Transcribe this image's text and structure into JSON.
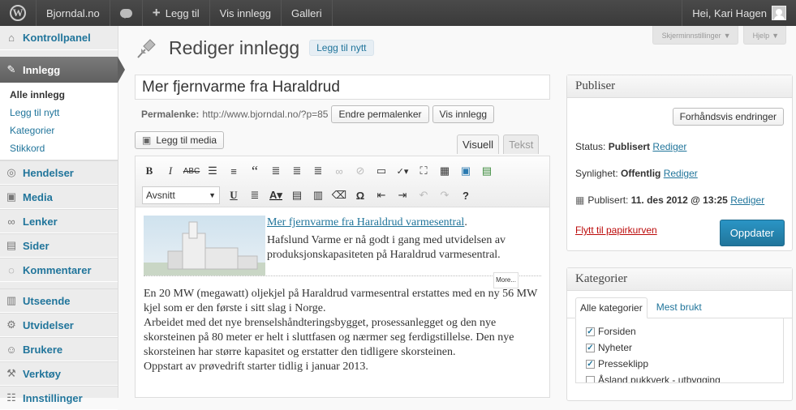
{
  "adminbar": {
    "site_name": "Bjorndal.no",
    "new_label": "Legg til",
    "view_posts": "Vis innlegg",
    "gallery": "Galleri",
    "greeting": "Hei, Kari Hagen"
  },
  "sidebar": {
    "dashboard": "Kontrollpanel",
    "posts": "Innlegg",
    "posts_sub": [
      "Alle innlegg",
      "Legg til nytt",
      "Kategorier",
      "Stikkord"
    ],
    "items_a": [
      "Hendelser",
      "Media",
      "Lenker",
      "Sider",
      "Kommentarer"
    ],
    "items_b": [
      "Utseende",
      "Utvidelser",
      "Brukere",
      "Verktøy",
      "Innstillinger"
    ]
  },
  "screen_options": "Skjerminnstillinger",
  "help": "Hjelp",
  "page": {
    "heading": "Rediger innlegg",
    "add_new": "Legg til nytt",
    "post_title": "Mer fjernvarme fra Haraldrud",
    "permalink_label": "Permalenke:",
    "permalink_url": "http://www.bjorndal.no/?p=85",
    "change_permalinks": "Endre permalenker",
    "view_post": "Vis innlegg",
    "add_media": "Legg til media",
    "tab_visual": "Visuell",
    "tab_text": "Tekst",
    "format_select": "Avsnitt"
  },
  "content": {
    "link_text": "Mer fjernvarme fra Haraldrud varmesentral",
    "link_suffix": ".",
    "intro": "Hafslund Varme er nå godt i gang med utvidelsen av produksjonskapasiteten på Haraldrud varmesentral.",
    "more_tag": "More...",
    "p1": "En 20 MW (megawatt) oljekjel på Haraldrud varmesentral erstattes med en ny 56 MW kjel som er den første i sitt slag i Norge.",
    "p2": "Arbeidet med det nye brenselshåndteringsbygget, prosessanlegget og den nye skorsteinen på 80 meter er helt i sluttfasen og nærmer seg ferdigstillelse. Den nye skorsteinen har større kapasitet og erstatter den tidligere skorsteinen.",
    "p3": "Oppstart av prøvedrift starter tidlig i januar 2013."
  },
  "publish": {
    "title": "Publiser",
    "preview": "Forhåndsvis endringer",
    "status_label": "Status:",
    "status_value": "Publisert",
    "visibility_label": "Synlighet:",
    "visibility_value": "Offentlig",
    "published_label": "Publisert:",
    "published_value": "11. des 2012 @ 13:25",
    "edit": "Rediger",
    "trash": "Flytt til papirkurven",
    "update": "Oppdater"
  },
  "categories": {
    "title": "Kategorier",
    "tab_all": "Alle kategorier",
    "tab_popular": "Mest brukt",
    "items": [
      {
        "label": "Forsiden",
        "checked": true
      },
      {
        "label": "Nyheter",
        "checked": true
      },
      {
        "label": "Presseklipp",
        "checked": true
      },
      {
        "label": "Åsland pukkverk - utbygging",
        "checked": false
      }
    ]
  }
}
